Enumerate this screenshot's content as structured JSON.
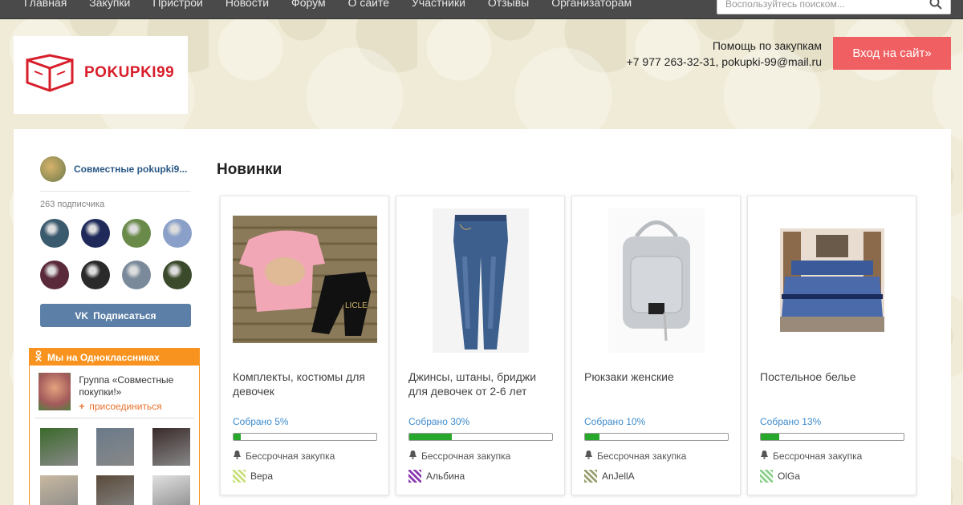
{
  "nav": {
    "items": [
      "Главная",
      "Закупки",
      "Пристрой",
      "Новости",
      "Форум",
      "О сайте",
      "Участники",
      "Отзывы",
      "Организаторам"
    ],
    "search_placeholder": "Воспользуйтесь поиском...",
    "search_icon": "search-icon"
  },
  "header": {
    "logo_text": "POKUPKI99",
    "help_title": "Помощь по закупкам",
    "help_contacts": "+7 977 263-32-31, pokupki-99@mail.ru",
    "login_label": "Вход на сайт»"
  },
  "vk": {
    "group_name": "Совместные pokupki9...",
    "subscribers": "263 подписчика",
    "subscribe_label": "Подписаться",
    "icon_text": "VK",
    "avatar_colors": [
      "#3a5a6e",
      "#1f2a5a",
      "#6a8a4a",
      "#8aa0c8",
      "#5a2a3a",
      "#2a2a2a",
      "#7a8a9a",
      "#3a4a2a"
    ]
  },
  "ok": {
    "header": "Мы на Одноклассниках",
    "group_name": "Группа «Совместные покупки!»",
    "join_label": "присоединиться",
    "photo_colors": [
      "#3a6a2a",
      "#6a7a8a",
      "#3a2a2a",
      "#c8b8a0",
      "#5a4a3a",
      "#e0e0e0"
    ]
  },
  "main": {
    "title": "Новинки",
    "cards": [
      {
        "title": "Комплекты, костюмы для девочек",
        "collected": "Собрано 5%",
        "progress": 5,
        "perm": "Бессрочная закупка",
        "organizer": "Вера",
        "org_color": "#c8e07a"
      },
      {
        "title": "Джинсы, штаны, бриджи для девочек от 2-6 лет",
        "collected": "Собрано 30%",
        "progress": 30,
        "perm": "Бессрочная закупка",
        "organizer": "Альбина",
        "org_color": "#8a3ab0"
      },
      {
        "title": "Рюкзаки женские",
        "collected": "Собрано 10%",
        "progress": 10,
        "perm": "Бессрочная закупка",
        "organizer": "AnJellA",
        "org_color": "#9aa070"
      },
      {
        "title": "Постельное белье",
        "collected": "Собрано 13%",
        "progress": 13,
        "perm": "Бессрочная закупка",
        "organizer": "OlGa",
        "org_color": "#8ad08a"
      }
    ]
  }
}
